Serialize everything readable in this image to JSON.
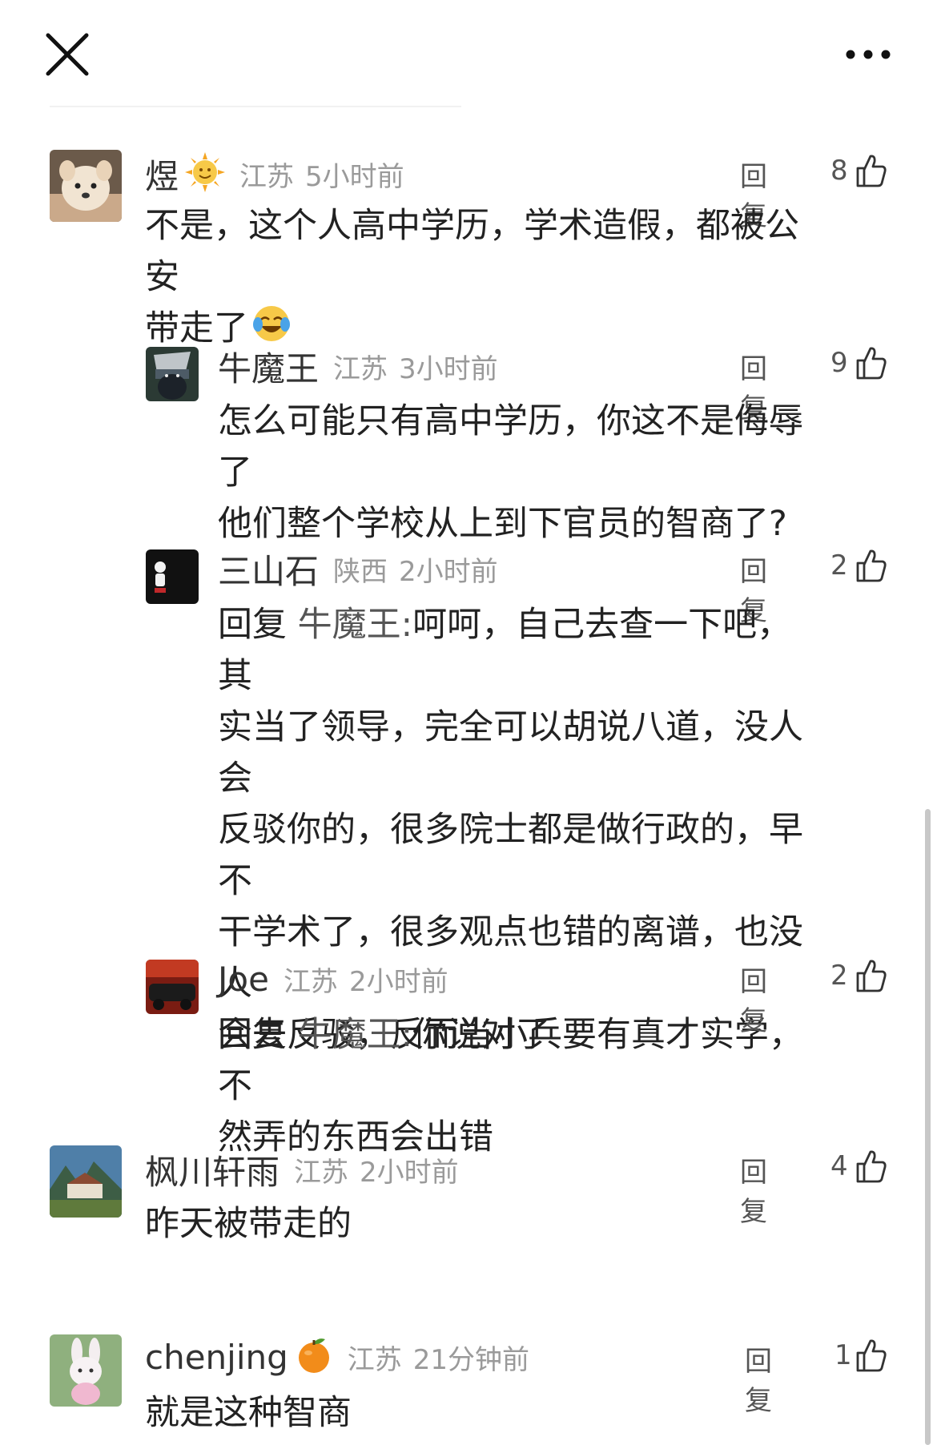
{
  "toolbar": {
    "close_icon": "close-icon",
    "more_icon": "more-horizontal-icon"
  },
  "comments": [
    {
      "username": "煜",
      "user_emoji": "sun-face-emoji",
      "location": "江苏",
      "time": "5小时前",
      "reply_label": "回复",
      "likes": "8",
      "lines": [
        "不是，这个人高中学历，学术造假，都被公安",
        "带走了"
      ],
      "content_emoji": "crying-laughing-emoji"
    },
    {
      "username": "牛魔王",
      "location": "江苏",
      "time": "3小时前",
      "reply_label": "回复",
      "likes": "9",
      "lines": [
        "怎么可能只有高中学历，你这不是侮辱了",
        "他们整个学校从上到下官员的智商了?"
      ]
    },
    {
      "username": "三山石",
      "location": "陕西",
      "time": "2小时前",
      "reply_label": "回复",
      "likes": "2",
      "reply_prefix": "回复",
      "reply_target": "牛魔王:",
      "lines": [
        "呵呵，自己去查一下吧，其",
        "实当了领导，完全可以胡说八道，没人会",
        "反驳你的，很多院士都是做行政的，早不",
        "干学术了，很多观点也错的离谱，也没人",
        "会去反驳，反而当小兵要有真才实学，不",
        "然弄的东西会出错"
      ]
    },
    {
      "username": "Joe",
      "location": "江苏",
      "time": "2小时前",
      "reply_label": "回复",
      "likes": "2",
      "reply_prefix": "回复",
      "reply_target": "牛魔王:",
      "lines": [
        "你说对了"
      ]
    },
    {
      "username": "枫川轩雨",
      "location": "江苏",
      "time": "2小时前",
      "reply_label": "回复",
      "likes": "4",
      "lines": [
        "昨天被带走的"
      ]
    },
    {
      "username": "chenjing",
      "user_emoji": "orange-emoji",
      "location": "江苏",
      "time": "21分钟前",
      "reply_label": "回复",
      "likes": "1",
      "lines": [
        "就是这种智商"
      ]
    }
  ]
}
